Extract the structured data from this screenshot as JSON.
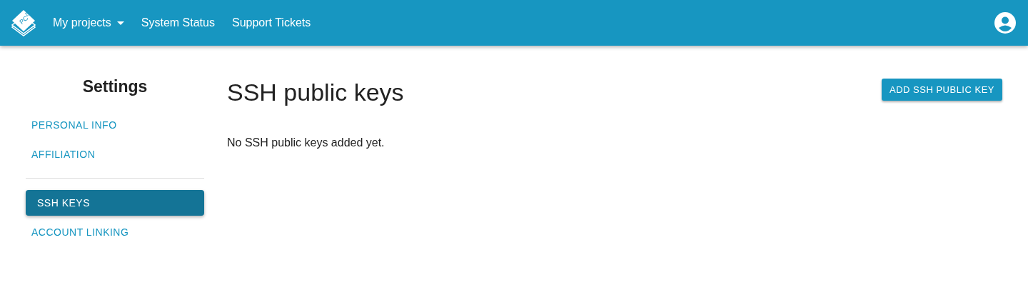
{
  "navbar": {
    "logo_text": "PC$^{2}$",
    "menu": [
      {
        "label": "My projects",
        "kind": "dropdown"
      },
      {
        "label": "System Status",
        "kind": "link"
      },
      {
        "label": "Support Tickets",
        "kind": "link"
      }
    ]
  },
  "sidebar": {
    "title": "Settings",
    "groups": [
      [
        {
          "label": "PERSONAL INFO",
          "selected": false
        },
        {
          "label": "AFFILIATION",
          "selected": false
        }
      ],
      [
        {
          "label": "SSH KEYS",
          "selected": true
        },
        {
          "label": "ACCOUNT LINKING",
          "selected": false
        }
      ]
    ]
  },
  "main": {
    "title": "SSH public keys",
    "button": "ADD SSH PUBLIC KEY",
    "empty_message": "No SSH public keys added yet."
  }
}
